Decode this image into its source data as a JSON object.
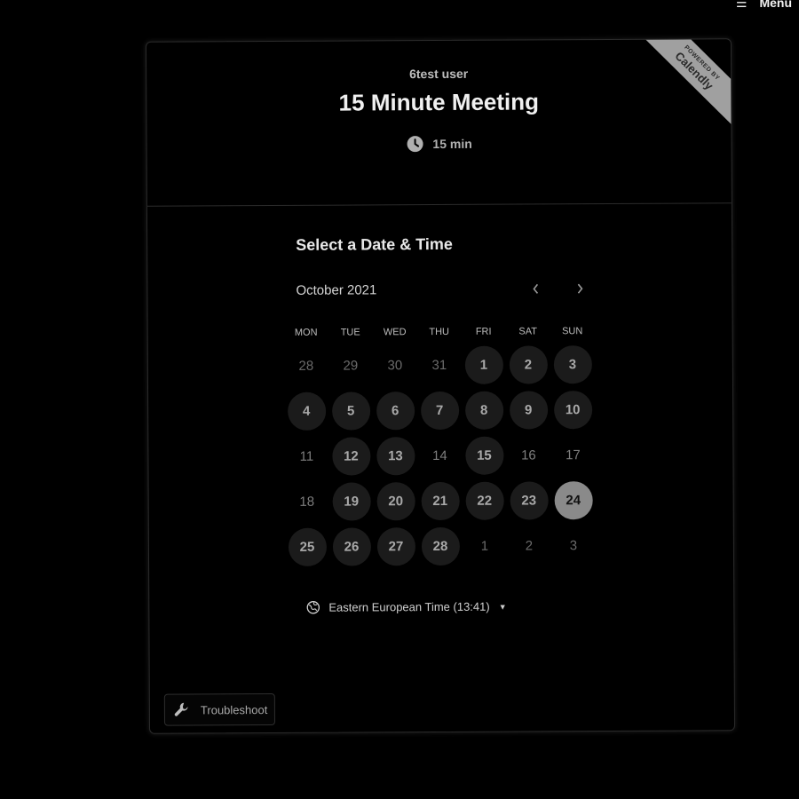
{
  "top_menu": {
    "icon": "hamburger-icon",
    "label": "Menu"
  },
  "header": {
    "user_name": "6test user",
    "title": "15 Minute Meeting",
    "duration": "15 min",
    "duration_icon": "clock-icon",
    "ribbon": {
      "small": "POWERED BY",
      "brand": "Calendly"
    }
  },
  "scheduler": {
    "heading": "Select a Date & Time",
    "month": "October 2021",
    "prev_icon": "chevron-left-icon",
    "next_icon": "chevron-right-icon",
    "weekdays": [
      "MON",
      "TUE",
      "WED",
      "THU",
      "FRI",
      "SAT",
      "SUN"
    ],
    "days": [
      {
        "label": "28",
        "state": "outside"
      },
      {
        "label": "29",
        "state": "outside"
      },
      {
        "label": "30",
        "state": "outside"
      },
      {
        "label": "31",
        "state": "outside"
      },
      {
        "label": "1",
        "state": "available"
      },
      {
        "label": "2",
        "state": "available"
      },
      {
        "label": "3",
        "state": "available"
      },
      {
        "label": "4",
        "state": "available"
      },
      {
        "label": "5",
        "state": "available"
      },
      {
        "label": "6",
        "state": "available"
      },
      {
        "label": "7",
        "state": "available"
      },
      {
        "label": "8",
        "state": "available"
      },
      {
        "label": "9",
        "state": "available"
      },
      {
        "label": "10",
        "state": "available"
      },
      {
        "label": "11",
        "state": "unavailable"
      },
      {
        "label": "12",
        "state": "available"
      },
      {
        "label": "13",
        "state": "available"
      },
      {
        "label": "14",
        "state": "unavailable"
      },
      {
        "label": "15",
        "state": "available"
      },
      {
        "label": "16",
        "state": "unavailable"
      },
      {
        "label": "17",
        "state": "unavailable"
      },
      {
        "label": "18",
        "state": "unavailable"
      },
      {
        "label": "19",
        "state": "available"
      },
      {
        "label": "20",
        "state": "available"
      },
      {
        "label": "21",
        "state": "available"
      },
      {
        "label": "22",
        "state": "available"
      },
      {
        "label": "23",
        "state": "available"
      },
      {
        "label": "24",
        "state": "selected"
      },
      {
        "label": "25",
        "state": "available"
      },
      {
        "label": "26",
        "state": "available"
      },
      {
        "label": "27",
        "state": "available"
      },
      {
        "label": "28",
        "state": "available"
      },
      {
        "label": "1",
        "state": "outside"
      },
      {
        "label": "2",
        "state": "outside"
      },
      {
        "label": "3",
        "state": "outside"
      }
    ],
    "timezone": {
      "icon": "globe-icon",
      "label": "Eastern European Time (13:41)",
      "caret_icon": "caret-down-icon"
    }
  },
  "footer": {
    "troubleshoot_icon": "wrench-icon",
    "troubleshoot_label": "Troubleshoot"
  },
  "colors": {
    "background": "#000000",
    "available_day_bg": "#1b1b1b",
    "selected_day_bg": "#8a8a8a",
    "ribbon_bg": "#a0a0a0"
  }
}
